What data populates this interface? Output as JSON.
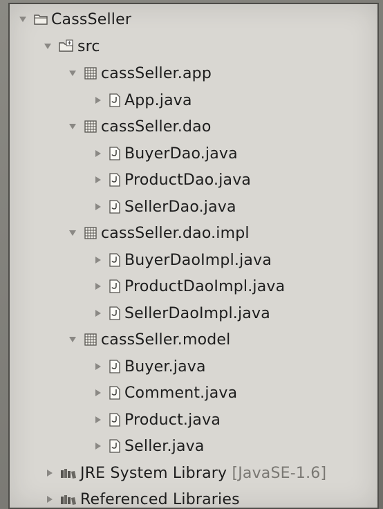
{
  "tree": {
    "project": "CassSeller",
    "src": "src",
    "packages": [
      {
        "name": "cassSeller.app",
        "files": [
          "App.java"
        ]
      },
      {
        "name": "cassSeller.dao",
        "files": [
          "BuyerDao.java",
          "ProductDao.java",
          "SellerDao.java"
        ]
      },
      {
        "name": "cassSeller.dao.impl",
        "files": [
          "BuyerDaoImpl.java",
          "ProductDaoImpl.java",
          "SellerDaoImpl.java"
        ]
      },
      {
        "name": "cassSeller.model",
        "files": [
          "Buyer.java",
          "Comment.java",
          "Product.java",
          "Seller.java"
        ]
      }
    ],
    "libraries": [
      {
        "label": "JRE System Library",
        "suffix": "[JavaSE-1.6]"
      },
      {
        "label": "Referenced Libraries",
        "suffix": ""
      }
    ]
  },
  "icons": {
    "project": "project-folder-icon",
    "src": "source-folder-icon",
    "package": "package-icon",
    "java_file": "java-file-icon",
    "library": "library-icon"
  },
  "colors": {
    "panel_bg": "#d9d7d2",
    "text": "#1d1d1d",
    "arrow": "#8a8884",
    "library_suffix": "#7a7873"
  }
}
